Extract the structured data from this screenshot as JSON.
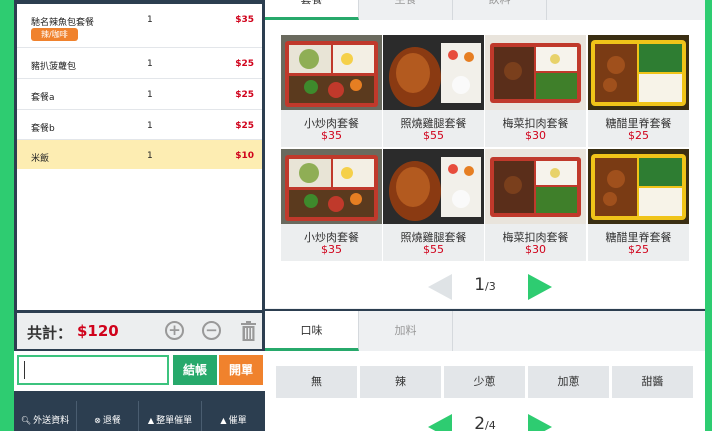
{
  "order": {
    "items": [
      {
        "name": "馳名辣魚包套餐",
        "qty": "1",
        "price": "$35",
        "tag": "辣/咖啡"
      },
      {
        "name": "豬扒菠蘿包",
        "qty": "1",
        "price": "$25"
      },
      {
        "name": "套餐a",
        "qty": "1",
        "price": "$25"
      },
      {
        "name": "套餐b",
        "qty": "1",
        "price": "$25"
      },
      {
        "name": "米飯",
        "qty": "1",
        "price": "$10"
      }
    ],
    "total_label": "共計：",
    "total_value": "$120"
  },
  "actions": {
    "input_value": "",
    "checkout_label": "結帳",
    "open_label": "開單"
  },
  "bottom_buttons": [
    {
      "label": "外送資料",
      "icon": "search-icon"
    },
    {
      "label": "退餐",
      "icon": "close-circle-icon"
    },
    {
      "label": "整單催單",
      "icon": "bell-icon"
    },
    {
      "label": "催單",
      "icon": "bell-icon"
    }
  ],
  "menu": {
    "tabs": [
      "套餐",
      "主食",
      "飲料"
    ],
    "items": [
      {
        "name": "小炒肉套餐",
        "price": "$35"
      },
      {
        "name": "照燒雞腿套餐",
        "price": "$55"
      },
      {
        "name": "梅菜扣肉套餐",
        "price": "$30"
      },
      {
        "name": "糖醋里脊套餐",
        "price": "$25"
      },
      {
        "name": "小炒肉套餐",
        "price": "$35"
      },
      {
        "name": "照燒雞腿套餐",
        "price": "$55"
      },
      {
        "name": "梅菜扣肉套餐",
        "price": "$30"
      },
      {
        "name": "糖醋里脊套餐",
        "price": "$25"
      }
    ],
    "page_current": "1",
    "page_total": "/3"
  },
  "options": {
    "tabs": [
      "口味",
      "加料"
    ],
    "items": [
      "無",
      "辣",
      "少蔥",
      "加蔥",
      "甜醬"
    ],
    "page_current": "2",
    "page_total": "/4"
  },
  "colors": {
    "accent_green": "#2ecc71",
    "dark_navy": "#2c3e50",
    "price_red": "#d0021b",
    "orange": "#f0822d"
  }
}
